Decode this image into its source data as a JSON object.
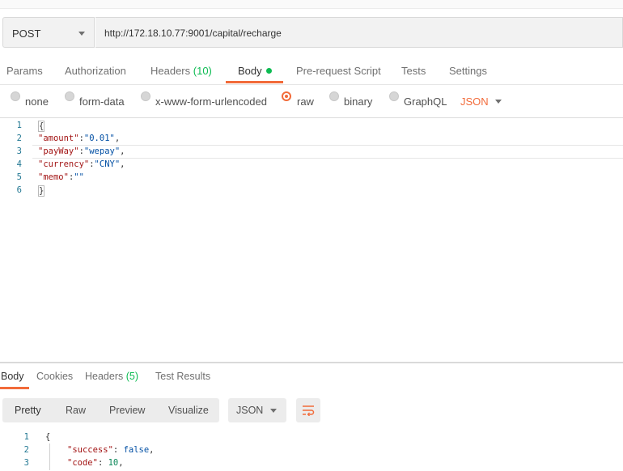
{
  "request": {
    "method": "POST",
    "url": "http://172.18.10.77:9001/capital/recharge"
  },
  "request_tabs": [
    {
      "label": "Params"
    },
    {
      "label": "Authorization"
    },
    {
      "label": "Headers",
      "count": "(10)"
    },
    {
      "label": "Body"
    },
    {
      "label": "Pre-request Script"
    },
    {
      "label": "Tests"
    },
    {
      "label": "Settings"
    }
  ],
  "body_types": {
    "options": [
      "none",
      "form-data",
      "x-www-form-urlencoded",
      "raw",
      "binary",
      "GraphQL"
    ],
    "selected": "raw",
    "format": "JSON"
  },
  "editor": {
    "lines": [
      {
        "num": "1",
        "text": "{"
      },
      {
        "num": "2",
        "key": "\"amount\"",
        "sep": ":",
        "value": "\"0.01\"",
        "end": ","
      },
      {
        "num": "3",
        "key": "\"payWay\"",
        "sep": ":",
        "value": "\"wepay\"",
        "end": ","
      },
      {
        "num": "4",
        "key": "\"currency\"",
        "sep": ":",
        "value": "\"CNY\"",
        "end": ","
      },
      {
        "num": "5",
        "key": "\"memo\"",
        "sep": ":",
        "value": "\"\"",
        "end": ""
      },
      {
        "num": "6",
        "text": "}"
      }
    ]
  },
  "response": {
    "tabs": [
      {
        "label": "Body"
      },
      {
        "label": "Cookies"
      },
      {
        "label": "Headers",
        "count": "(5)"
      },
      {
        "label": "Test Results"
      }
    ],
    "views": [
      "Pretty",
      "Raw",
      "Preview",
      "Visualize"
    ],
    "active_view": "Pretty",
    "format": "JSON",
    "lines": [
      {
        "num": "1",
        "text": "{"
      },
      {
        "num": "2",
        "key": "\"success\"",
        "sep": ": ",
        "value": "false",
        "end": ","
      },
      {
        "num": "3",
        "key": "\"code\"",
        "sep": ": ",
        "value": "10",
        "end": ","
      }
    ]
  },
  "colors": {
    "accent": "#f26b3a",
    "count_green": "#0cbb52"
  },
  "icons": {
    "method_caret": "chevron-down-icon",
    "format_caret": "chevron-down-icon",
    "wrap": "wrap-lines-icon",
    "body_dot": "status-dot-icon"
  }
}
